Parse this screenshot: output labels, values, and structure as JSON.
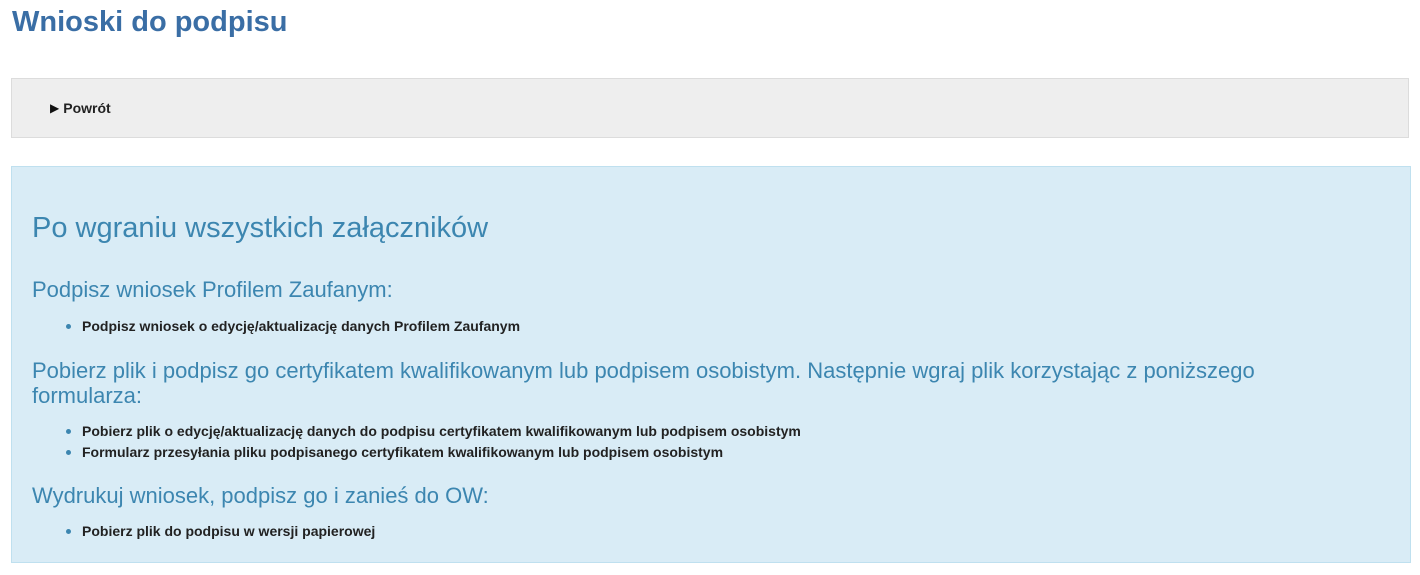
{
  "page_title": "Wnioski do podpisu",
  "toolbar": {
    "back_label": "Powrót"
  },
  "panel": {
    "title": "Po wgraniu wszystkich załączników",
    "sections": [
      {
        "heading": "Podpisz wniosek Profilem Zaufanym:",
        "items": [
          "Podpisz wniosek o edycję/aktualizację danych Profilem Zaufanym"
        ]
      },
      {
        "heading": "Pobierz plik i podpisz go certyfikatem kwalifikowanym lub podpisem osobistym. Następnie wgraj plik korzystając z poniższego formularza:",
        "items": [
          "Pobierz plik o edycję/aktualizację danych do podpisu certyfikatem kwalifikowanym lub podpisem osobistym",
          "Formularz przesyłania pliku podpisanego certyfikatem kwalifikowanym lub podpisem osobistym"
        ]
      },
      {
        "heading": "Wydrukuj wniosek, podpisz go i zanieś do OW:",
        "items": [
          "Pobierz plik do podpisu w wersji papierowej"
        ]
      }
    ]
  },
  "colors": {
    "title": "#3a6ea5",
    "accent": "#3c86b0",
    "panel_bg": "#d9ecf6",
    "toolbar_bg": "#eeeeee"
  }
}
